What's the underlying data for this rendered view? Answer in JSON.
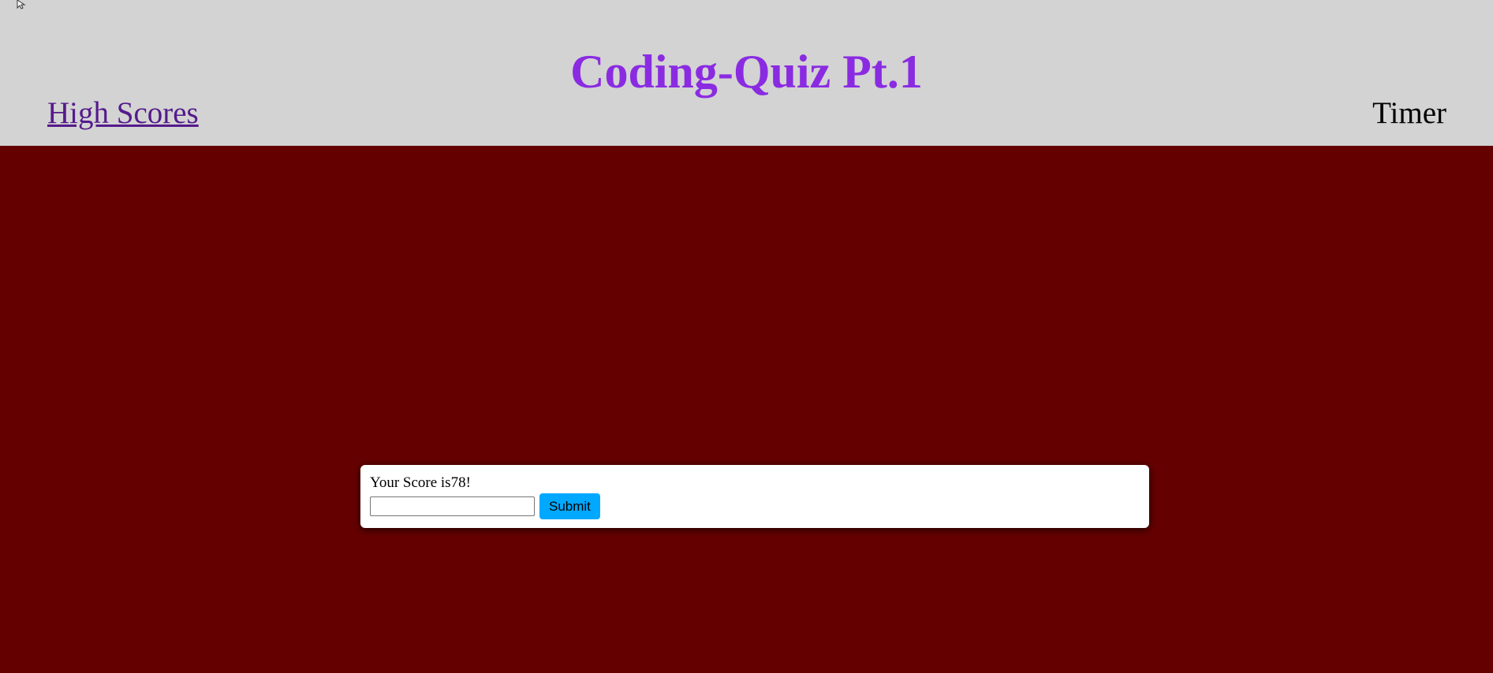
{
  "header": {
    "title": "Coding-Quiz Pt.1",
    "high_scores_link": "High Scores",
    "timer_label": "Timer"
  },
  "score_form": {
    "score_text": "Your Score is78!",
    "initials_value": "",
    "submit_label": "Submit"
  },
  "colors": {
    "header_background": "#d3d3d3",
    "page_background": "#650000",
    "title": "#8a2be2",
    "link": "#551a8b",
    "submit_button": "#00a8ff",
    "card_background": "#ffffff"
  },
  "icons": {
    "cursor": "mouse-pointer-icon"
  }
}
